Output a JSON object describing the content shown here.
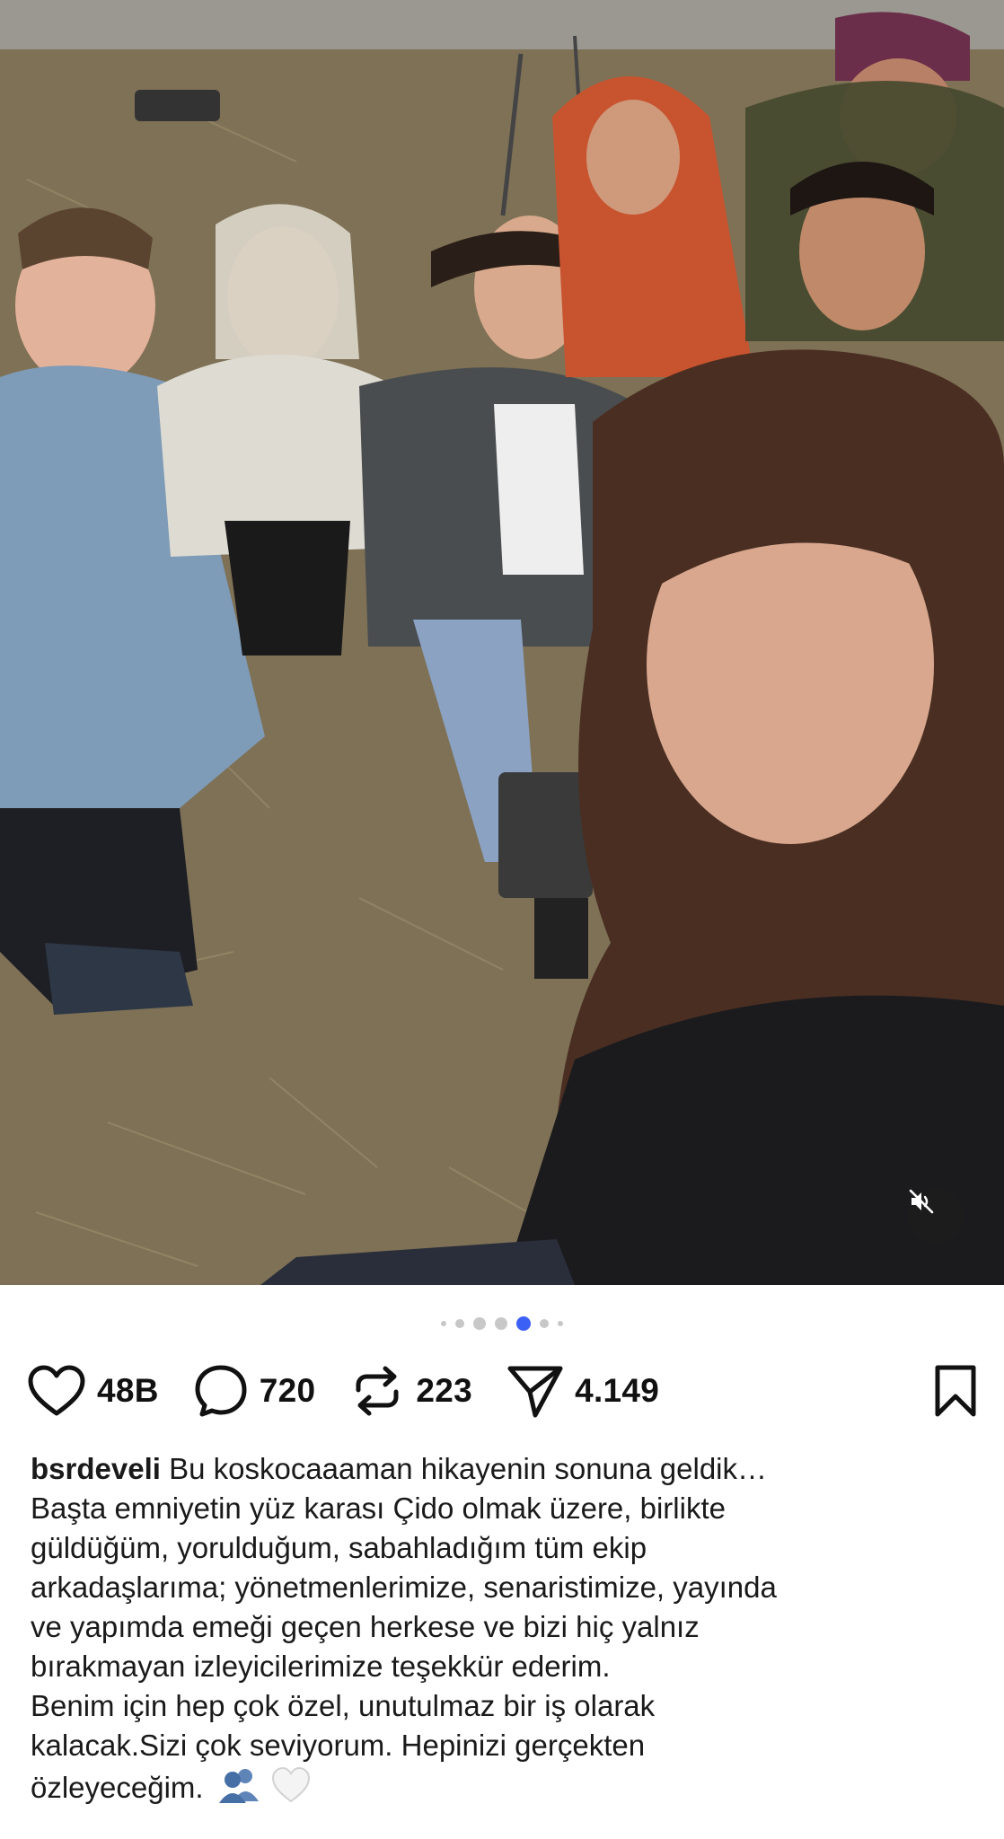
{
  "post": {
    "photo_description_icon": "group-selfie-photo",
    "carousel": {
      "total": 7,
      "active_index": 3
    },
    "mute_icon": "speaker-muted-icon"
  },
  "actions": {
    "like": {
      "icon": "heart-icon",
      "count": "48B"
    },
    "comment": {
      "icon": "comment-bubble-icon",
      "count": "720"
    },
    "repost": {
      "icon": "repost-icon",
      "count": "223"
    },
    "share": {
      "icon": "send-icon",
      "count": "4.149"
    },
    "save": {
      "icon": "bookmark-icon"
    }
  },
  "caption": {
    "username": "bsrdeveli",
    "first_line": "Bu koskocaaaman hikayenin sonuna geldik…",
    "lines": [
      "Başta emniyetin yüz karası Çido olmak üzere, birlikte",
      "güldüğüm, yorulduğum, sabahladığım tüm ekip",
      "arkadaşlarıma; yönetmenlerimize, senaristimize, yayında",
      "ve yapımda emeği geçen herkese ve bizi hiç yalnız",
      "bırakmayan izleyicilerimize teşekkür ederim."
    ],
    "paragraph2_lines": [
      "Benim için hep çok özel, unutulmaz bir iş olarak",
      "kalacak.Sizi çok seviyorum. Hepinizi gerçekten"
    ],
    "last_line": "özleyeceğim.",
    "emojis": [
      "busts-in-silhouette-icon",
      "white-heart-icon"
    ]
  },
  "colors": {
    "accent_dot": "#3b60f5",
    "text": "#111111"
  }
}
